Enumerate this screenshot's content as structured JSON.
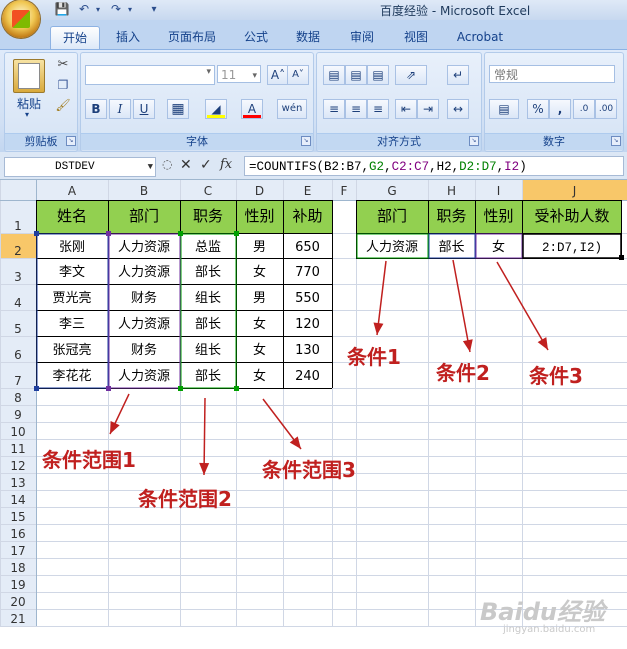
{
  "window": {
    "title": "百度经验 - Microsoft Excel"
  },
  "ribbon": {
    "tabs": [
      "开始",
      "插入",
      "页面布局",
      "公式",
      "数据",
      "审阅",
      "视图",
      "Acrobat"
    ],
    "groups": {
      "clipboard": {
        "label": "剪贴板",
        "paste_label": "粘贴"
      },
      "font": {
        "label": "字体",
        "font_size": "11"
      },
      "alignment": {
        "label": "对齐方式"
      },
      "number": {
        "label": "数字",
        "format": "常规"
      }
    }
  },
  "formula_bar": {
    "name_box": "DSTDEV",
    "fx": "fx",
    "formula_parts": [
      {
        "text": "=COUNTIFS(",
        "color": "#000000"
      },
      {
        "text": "B2:B7",
        "color": "#000000"
      },
      {
        "text": ",",
        "color": "#000000"
      },
      {
        "text": "G2",
        "color": "#008000"
      },
      {
        "text": ",",
        "color": "#000000"
      },
      {
        "text": "C2:C7",
        "color": "#800080"
      },
      {
        "text": ",",
        "color": "#000000"
      },
      {
        "text": "H2",
        "color": "#000000"
      },
      {
        "text": ",",
        "color": "#000000"
      },
      {
        "text": "D2:D7",
        "color": "#008000"
      },
      {
        "text": ",",
        "color": "#000000"
      },
      {
        "text": "I2",
        "color": "#800080"
      },
      {
        "text": ")",
        "color": "#000000"
      }
    ]
  },
  "sheet": {
    "columns": [
      "A",
      "B",
      "C",
      "D",
      "E",
      "F",
      "G",
      "H",
      "I",
      "J"
    ],
    "rows": [
      "1",
      "2",
      "3",
      "4",
      "5",
      "6",
      "7",
      "8",
      "9",
      "10",
      "11",
      "12",
      "13",
      "14",
      "15",
      "16",
      "17",
      "18",
      "19",
      "20",
      "21"
    ],
    "table1": {
      "headers": [
        "姓名",
        "部门",
        "职务",
        "性别",
        "补助"
      ],
      "rows": [
        [
          "张刚",
          "人力资源",
          "总监",
          "男",
          "650"
        ],
        [
          "李文",
          "人力资源",
          "部长",
          "女",
          "770"
        ],
        [
          "贾光亮",
          "财务",
          "组长",
          "男",
          "550"
        ],
        [
          "李三",
          "人力资源",
          "部长",
          "女",
          "120"
        ],
        [
          "张冠亮",
          "财务",
          "组长",
          "女",
          "130"
        ],
        [
          "李花花",
          "人力资源",
          "部长",
          "女",
          "240"
        ]
      ]
    },
    "table2": {
      "headers": [
        "部门",
        "职务",
        "性别",
        "受补助人数"
      ],
      "row": [
        "人力资源",
        "部长",
        "女",
        "2:D7,I2)"
      ]
    },
    "header_fill": "#92d050"
  },
  "annotations": {
    "cond1": "条件1",
    "cond2": "条件2",
    "cond3": "条件3",
    "range1": "条件范围1",
    "range2": "条件范围2",
    "range3": "条件范围3"
  },
  "watermark": {
    "brand": "Baidu经验",
    "sub": "jingyan.baidu.com"
  }
}
